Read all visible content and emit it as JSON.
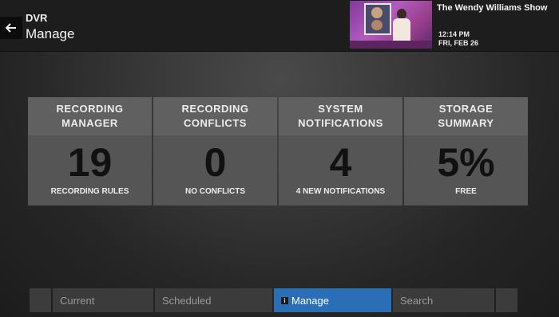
{
  "header": {
    "breadcrumb_parent": "DVR",
    "title": "Manage",
    "back_icon": "arrow-left-icon",
    "now_playing": {
      "show_title": "The Wendy Williams Show",
      "time": "12:14 PM",
      "date": "FRI, FEB 26"
    }
  },
  "tiles": [
    {
      "heading_line1": "RECORDING",
      "heading_line2": "MANAGER",
      "value": "19",
      "subtitle": "RECORDING RULES"
    },
    {
      "heading_line1": "RECORDING",
      "heading_line2": "CONFLICTS",
      "value": "0",
      "subtitle": "NO CONFLICTS"
    },
    {
      "heading_line1": "SYSTEM",
      "heading_line2": "NOTIFICATIONS",
      "value": "4",
      "subtitle": "4 NEW NOTIFICATIONS"
    },
    {
      "heading_line1": "STORAGE",
      "heading_line2": "SUMMARY",
      "value": "5%",
      "subtitle": "FREE"
    }
  ],
  "bottom_nav": {
    "tabs": [
      {
        "label": "Current",
        "active": false
      },
      {
        "label": "Scheduled",
        "active": false
      },
      {
        "label": "Manage",
        "active": true,
        "icon": "info-icon"
      },
      {
        "label": "Search",
        "active": false
      }
    ]
  },
  "colors": {
    "active_tab": "#2a6fb5",
    "tile_bg": "#555555",
    "tile_header_bg": "#606060",
    "header_bg": "#1d1d1d"
  }
}
